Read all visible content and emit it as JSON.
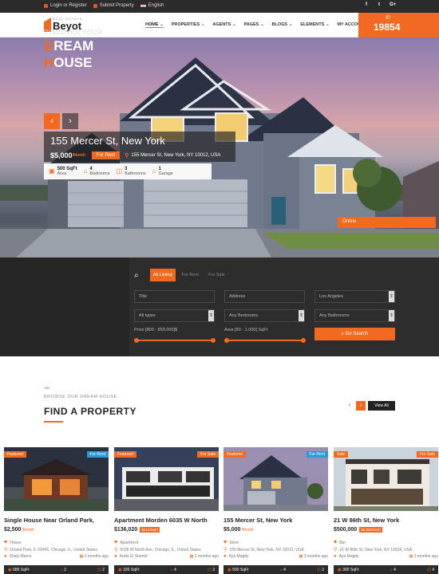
{
  "topbar": {
    "login": "Login or Register",
    "submit": "Submit Property",
    "language": "English",
    "social": [
      "f",
      "t",
      "G+"
    ]
  },
  "header": {
    "logo_sub": "REAL ESTATE",
    "logo": "Beyot",
    "nav": [
      "HOME",
      "PROPERTIES",
      "AGENTS",
      "PAGES",
      "BLOGS",
      "ELEMENTS",
      "MY ACCOUNT"
    ],
    "phone": "19854"
  },
  "hero": {
    "title": "155 Mercer St, New York",
    "price": "$5,000",
    "per": "/Month",
    "status": "For Rent",
    "address": "155 Mercer St, New York, NY 10012, USA",
    "features": [
      {
        "icon": "area-icon",
        "value": "500 SqFt",
        "label": "Area"
      },
      {
        "icon": "bed-icon",
        "value": "4",
        "label": "Bedrooms"
      },
      {
        "icon": "bath-icon",
        "value": "3",
        "label": "Bathrooms"
      },
      {
        "icon": "garage-icon",
        "value": "1",
        "label": "Garage"
      }
    ],
    "online": "Online",
    "prev": "‹",
    "next": "›"
  },
  "search": {
    "discover": "DISCOVER YOUR",
    "dream_first": "D",
    "dream_rest": "REAM",
    "house_first": "H",
    "house_rest": "OUSE",
    "tabs": [
      "All Listing",
      "For Rent",
      "For Sale"
    ],
    "title_ph": "Title",
    "address_ph": "Address",
    "location": "Los Angeles",
    "types": "All types",
    "bedrooms": "Any Bedrooms",
    "bathrooms": "Any Bathrooms",
    "price_label": "Price [800 - 850,000]$",
    "area_label": "Area [80 - 1,000] SqFt",
    "go": "Go Search"
  },
  "find": {
    "browse": "BROWSE OUR DREAM HOUSE",
    "title": "FIND A PROPERTY",
    "view_all": "View All",
    "prev": "‹",
    "next": "›"
  },
  "cards": [
    {
      "badge_l": "Featured",
      "badge_r": "For Rent",
      "badge_r_color": "#2a9ad6",
      "title": "Single House Near Orland Park,",
      "price": "$2,500",
      "per": "/Month",
      "tag": "",
      "type": "House",
      "address": "Orland Park, IL 60465, Chicago, IL, United States",
      "agent": "Shaly Marco",
      "date": "2 months ago",
      "area": "685 SqFt",
      "beds": "2",
      "baths": "2"
    },
    {
      "badge_l": "Featured",
      "badge_r": "For Sale",
      "badge_r_color": "#f26a21",
      "title": "Apartment Morden 6035 W North",
      "price": "$136,020",
      "per": "",
      "tag": "$612/SqFt",
      "type": "Apartment",
      "address": "6035 W North Ave, Chicago, IL, United States",
      "agent": "Arafa El Sherief",
      "date": "2 months ago",
      "area": "326 SqFt",
      "beds": "4",
      "baths": "3"
    },
    {
      "badge_l": "Featured",
      "badge_r": "For Rent",
      "badge_r_color": "#2a9ad6",
      "title": "155 Mercer St, New York",
      "price": "$5,000",
      "per": "/Month",
      "tag": "",
      "type": "Store",
      "address": "155 Mercer St, New York, NY 10012, USA",
      "agent": "Aya Magdy",
      "date": "3 months ago",
      "area": "500 SqFt",
      "beds": "4",
      "baths": "3"
    },
    {
      "badge_l": "Sale",
      "badge_r": "For Sale",
      "badge_r_color": "#f26a21",
      "title": "21 W 86th St, New York",
      "price": "$500,000",
      "per": "",
      "tag": "$5,000/SqFt",
      "type": "Bar",
      "address": "21 W 86th St, New York, NY 10024, USA",
      "agent": "Aya Magdy",
      "date": "3 months ago",
      "area": "300 SqFt",
      "beds": "4",
      "baths": "4"
    }
  ]
}
